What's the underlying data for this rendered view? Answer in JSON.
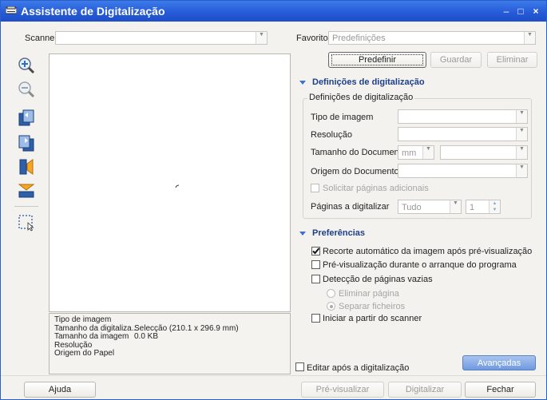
{
  "window": {
    "title": "Assistente de Digitalização"
  },
  "scanner": {
    "label": "Scanner",
    "value": ""
  },
  "favorites": {
    "label": "Favoritos:",
    "value": "Predefinições",
    "buttons": {
      "predefinir": "Predefinir",
      "guardar": "Guardar",
      "eliminar": "Eliminar"
    }
  },
  "scan_settings": {
    "section_title": "Definições de digitalização",
    "group_title": "Definições de digitalização",
    "tipo_imagem": "Tipo de imagem",
    "resolucao": "Resolução",
    "tamanho_documento": "Tamanho do Documento",
    "unidade": "mm",
    "origem_documento": "Origem do Documento",
    "solicitar_paginas": "Solicitar páginas adicionais",
    "paginas_digitalizar": "Páginas a digitalizar",
    "paginas_valor": "Tudo",
    "paginas_numero": "1"
  },
  "preferences": {
    "section_title": "Preferências",
    "recorte": "Recorte automático da imagem após pré-visualização",
    "pre_visualizacao": "Pré-visualização durante o arranque do programa",
    "deteccao": "Detecção de páginas vazias",
    "eliminar_pagina": "Eliminar página",
    "separar_ficheiros": "Separar ficheiros",
    "iniciar_scanner": "Iniciar a partir do scanner"
  },
  "info": {
    "rows": [
      {
        "label": "Tipo de imagem",
        "value": ""
      },
      {
        "label": "Tamanho da digitaliza...",
        "value": "Selecção (210.1 x 296.9 mm)"
      },
      {
        "label": "Tamanho da imagem",
        "value": "0.0 KB"
      },
      {
        "label": "Resolução",
        "value": ""
      },
      {
        "label": "Origem do Papel",
        "value": ""
      }
    ]
  },
  "footer": {
    "editar": "Editar após a digitalização",
    "avancadas": "Avançadas",
    "ajuda": "Ajuda",
    "pre_visualizar": "Pré-visualizar",
    "digitalizar": "Digitalizar",
    "fechar": "Fechar"
  }
}
